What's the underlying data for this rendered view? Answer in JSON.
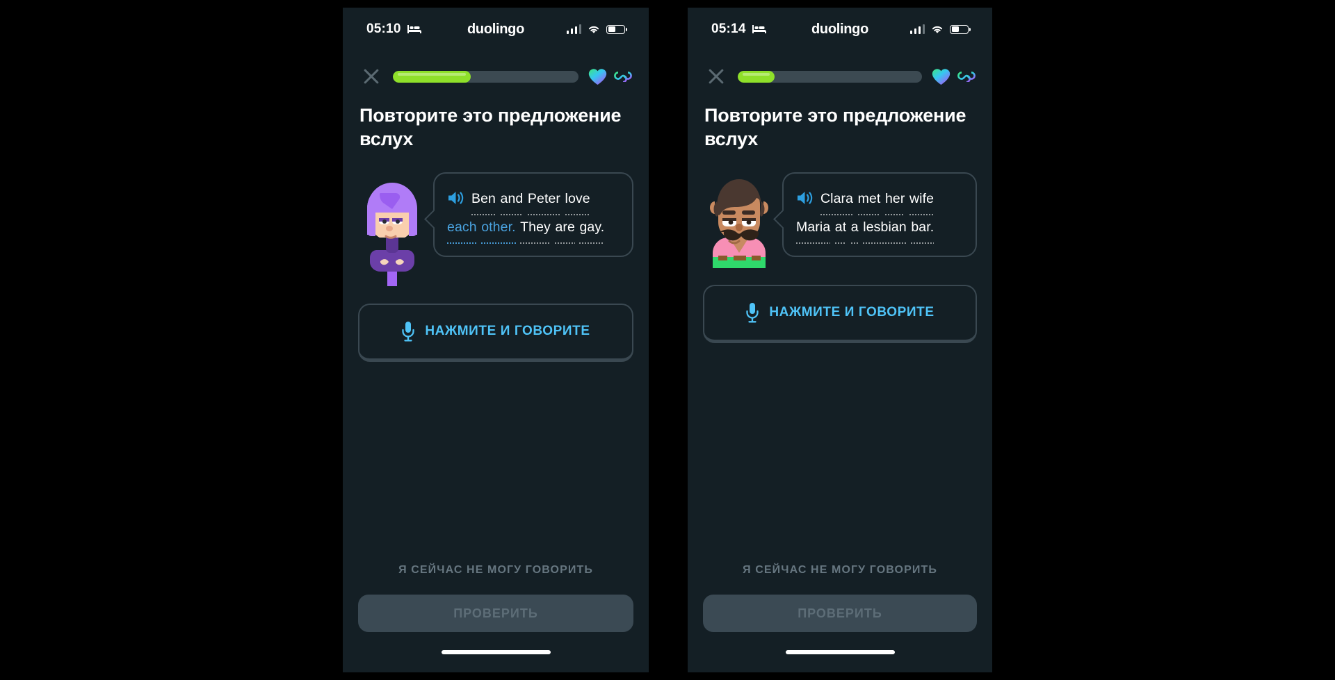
{
  "background_color": "#000000",
  "phone_background": "#141f25",
  "accent": {
    "progress_green": "#8fe02a",
    "progress_track": "#3c4a52",
    "mic_blue": "#4fc3f7",
    "highlight_blue": "#4aa3e0",
    "border_gray": "#3a4851",
    "muted_text": "#667680"
  },
  "phones": [
    {
      "id": "phone-left",
      "status_bar": {
        "time": "05:10",
        "sleep_icon": "bed-icon",
        "app_name": "duolingo",
        "signal_icon": "cellular-signal-icon",
        "wifi_icon": "wifi-icon",
        "battery_icon": "battery-icon",
        "battery_level_pct": 48
      },
      "header": {
        "close_icon": "close-x-icon",
        "progress_pct": 42,
        "heart_icon": "gradient-heart-icon",
        "infinity_label": "∞"
      },
      "lesson_title": "Повторите это предложение вслух",
      "character": "lily-avatar",
      "bubble": {
        "speaker_icon": "speaker-volume-icon",
        "lines": [
          {
            "tokens": [
              {
                "text": "Ben",
                "highlight": false
              },
              {
                "text": "and",
                "highlight": false
              },
              {
                "text": "Peter",
                "highlight": false
              }
            ]
          },
          {
            "tokens": [
              {
                "text": "love",
                "highlight": false
              },
              {
                "text": "each",
                "highlight": true
              },
              {
                "text": "other.",
                "highlight": true
              }
            ]
          },
          {
            "tokens": [
              {
                "text": "They",
                "highlight": false
              },
              {
                "text": "are",
                "highlight": false
              },
              {
                "text": "gay.",
                "highlight": false
              }
            ]
          }
        ],
        "plain_text": "Ben and Peter love each other. They are gay."
      },
      "mic_button": {
        "icon": "microphone-icon",
        "label": "НАЖМИТЕ И ГОВОРИТЕ"
      },
      "cant_speak_label": "Я СЕЙЧАС НЕ МОГУ ГОВОРИТЬ",
      "check_button_label": "ПРОВЕРИТЬ",
      "home_indicator": "home-indicator"
    },
    {
      "id": "phone-right",
      "status_bar": {
        "time": "05:14",
        "sleep_icon": "bed-icon",
        "app_name": "duolingo",
        "signal_icon": "cellular-signal-icon",
        "wifi_icon": "wifi-icon",
        "battery_icon": "battery-icon",
        "battery_level_pct": 48
      },
      "header": {
        "close_icon": "close-x-icon",
        "progress_pct": 20,
        "heart_icon": "gradient-heart-icon",
        "infinity_label": "∞"
      },
      "lesson_title": "Повторите это предложение вслух",
      "character": "zari-avatar",
      "bubble": {
        "speaker_icon": "speaker-volume-icon",
        "lines": [
          {
            "tokens": [
              {
                "text": "Clara",
                "highlight": false
              },
              {
                "text": "met",
                "highlight": false
              },
              {
                "text": "her",
                "highlight": false
              }
            ]
          },
          {
            "tokens": [
              {
                "text": "wife",
                "highlight": false
              },
              {
                "text": "Maria",
                "highlight": false
              },
              {
                "text": "at",
                "highlight": false
              },
              {
                "text": "a",
                "highlight": false
              }
            ]
          },
          {
            "tokens": [
              {
                "text": "lesbian",
                "highlight": false
              },
              {
                "text": "bar.",
                "highlight": false
              }
            ]
          }
        ],
        "plain_text": "Clara met her wife Maria at a lesbian bar."
      },
      "mic_button": {
        "icon": "microphone-icon",
        "label": "НАЖМИТЕ И ГОВОРИТЕ"
      },
      "cant_speak_label": "Я СЕЙЧАС НЕ МОГУ ГОВОРИТЬ",
      "check_button_label": "ПРОВЕРИТЬ",
      "home_indicator": "home-indicator"
    }
  ]
}
